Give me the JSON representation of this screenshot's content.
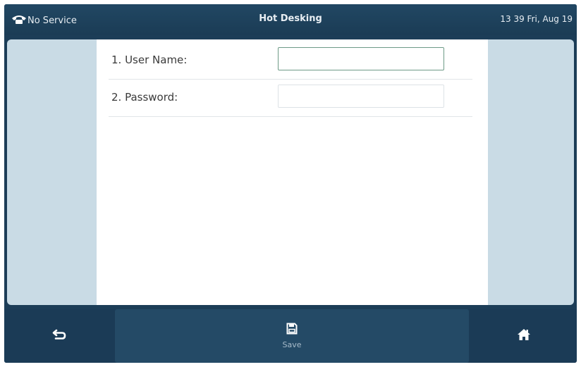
{
  "status_bar": {
    "phone_status": "No Service",
    "title": "Hot Desking",
    "datetime": "13 39 Fri, Aug 19",
    "phone_icon": "telephone-icon"
  },
  "form": {
    "fields": [
      {
        "label": "1. User Name:",
        "value": "",
        "focused": true
      },
      {
        "label": "2. Password:",
        "value": "",
        "focused": false
      }
    ]
  },
  "softkeys": {
    "back_icon": "back-arrow-icon",
    "save_label": "Save",
    "save_icon": "save-icon",
    "home_icon": "home-icon"
  },
  "colors": {
    "status_bar": "#1f4460",
    "softkey_bar": "#1b3b56",
    "side_panel": "#c9dbe5",
    "focus_border": "#6d9a86"
  }
}
